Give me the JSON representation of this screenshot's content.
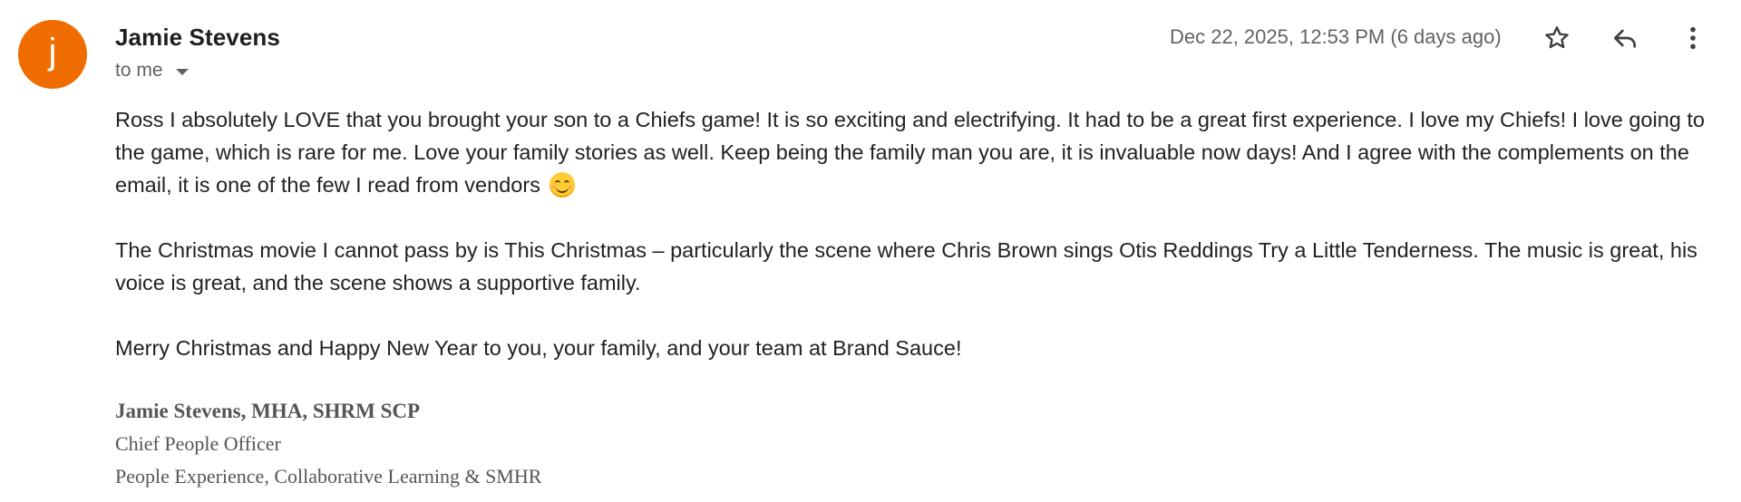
{
  "avatar": {
    "letter": "j",
    "color": "#ef6c00"
  },
  "sender": {
    "name": "Jamie Stevens"
  },
  "recipients": {
    "label": "to me"
  },
  "datetime": "Dec 22, 2025, 12:53 PM (6 days ago)",
  "actions": {
    "star_icon": "star-icon",
    "reply_icon": "reply-icon",
    "more_icon": "more-vert-icon"
  },
  "body": {
    "p1": "Ross I absolutely LOVE that you brought your son to a Chiefs game! It is so exciting and electrifying. It had to be a great first experience. I love my Chiefs! I love going to the game, which is rare for me. Love your family stories as well. Keep being the family man you are, it is invaluable now days! And I agree with the complements on the email, it is one of the few I read from vendors",
    "p1_emoji": "😊",
    "p2": "The Christmas movie I cannot pass by is This Christmas – particularly the scene where Chris Brown sings Otis Reddings Try a Little Tenderness. The music is great, his voice is great, and the scene shows a supportive family.",
    "p3": "Merry Christmas and Happy New Year to you, your family, and your team at Brand Sauce!"
  },
  "signature": {
    "name": "Jamie Stevens, MHA, SHRM SCP",
    "title": "Chief People Officer",
    "dept": "People Experience, Collaborative Learning & SMHR"
  }
}
